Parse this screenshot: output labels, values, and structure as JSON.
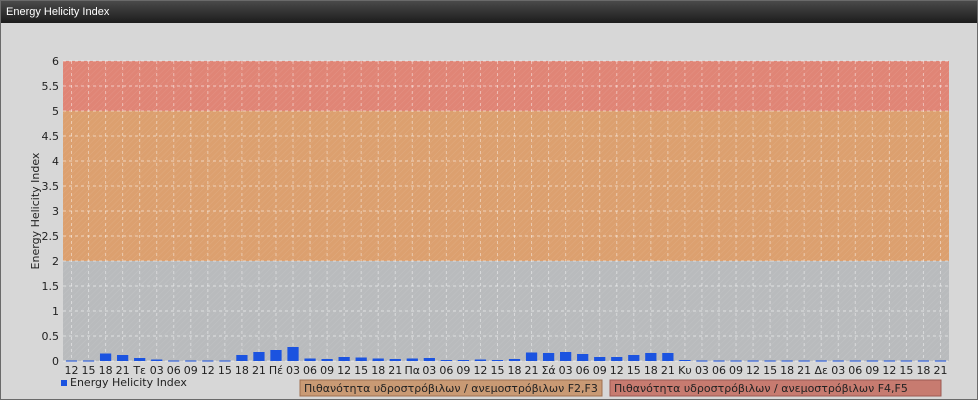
{
  "window": {
    "title": "Energy Helicity Index"
  },
  "colors": {
    "band_low": "#b9bbbd",
    "band_mid": "#dca06f",
    "band_high": "#e08576",
    "bar": "#1b53e0",
    "background": "#d7d7d7",
    "legend_f23": "#c99a74",
    "legend_f45": "#c77b70"
  },
  "bands": [
    {
      "from": 0,
      "to": 2,
      "color_key": "band_low"
    },
    {
      "from": 2,
      "to": 5,
      "color_key": "band_mid"
    },
    {
      "from": 5,
      "to": 6,
      "color_key": "band_high"
    }
  ],
  "legend": {
    "series_label": "Energy Helicity Index",
    "f23_label": "Πιθανότητα υδροστρόβιλων / ανεμοστρόβιλων F2,F3",
    "f45_label": "Πιθανότητα υδροστρόβιλων / ανεμοστρόβιλων F4,F5"
  },
  "chart_data": {
    "type": "bar",
    "title": "",
    "xlabel": "",
    "ylabel": "Energy Helicity Index",
    "ylim": [
      0,
      6
    ],
    "yticks": [
      0,
      0.5,
      1,
      1.5,
      2,
      2.5,
      3,
      3.5,
      4,
      4.5,
      5,
      5.5,
      6
    ],
    "grid": true,
    "legend_position": "bottom-left",
    "categories": [
      "12",
      "15",
      "18",
      "21",
      "Τε",
      "03",
      "06",
      "09",
      "12",
      "15",
      "18",
      "21",
      "Πέ",
      "03",
      "06",
      "09",
      "12",
      "15",
      "18",
      "21",
      "Πα",
      "03",
      "06",
      "09",
      "12",
      "15",
      "18",
      "21",
      "Σά",
      "03",
      "06",
      "09",
      "12",
      "15",
      "18",
      "21",
      "Κυ",
      "03",
      "06",
      "09",
      "12",
      "15",
      "18",
      "21",
      "Δε",
      "03",
      "06",
      "09",
      "12",
      "15",
      "18",
      "21"
    ],
    "series": [
      {
        "name": "Energy Helicity Index",
        "values": [
          0.01,
          0.01,
          0.15,
          0.12,
          0.06,
          0.03,
          0.01,
          0.01,
          0.01,
          0.01,
          0.12,
          0.18,
          0.22,
          0.28,
          0.05,
          0.04,
          0.08,
          0.07,
          0.05,
          0.04,
          0.05,
          0.06,
          0.02,
          0.02,
          0.03,
          0.02,
          0.04,
          0.17,
          0.16,
          0.18,
          0.14,
          0.08,
          0.08,
          0.12,
          0.16,
          0.16,
          0.02,
          0.01,
          0.01,
          0.01,
          0.01,
          0.01,
          0.01,
          0.01,
          0.01,
          0.01,
          0.01,
          0.01,
          0.01,
          0.01,
          0.01,
          0.01
        ]
      }
    ]
  }
}
